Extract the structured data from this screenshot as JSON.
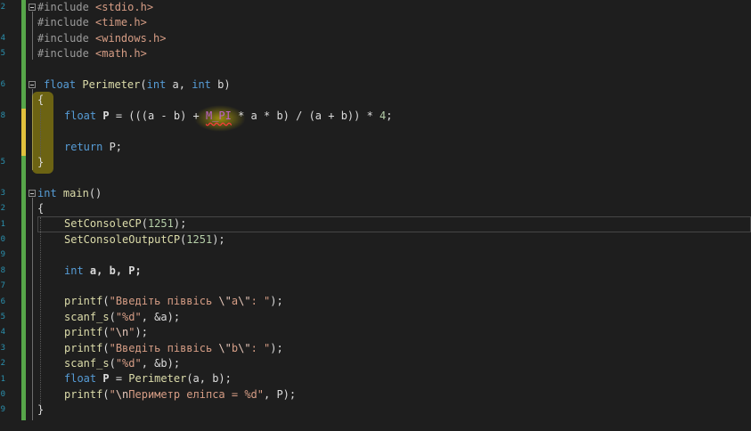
{
  "colors": {
    "background": "#1e1e1e",
    "keyword": "#569cd6",
    "function": "#dcdcaa",
    "string": "#d69d85",
    "macro": "#bd63c5",
    "number": "#b5cea8",
    "changed_saved": "#57a64a",
    "changed_unsaved": "#e2c13d",
    "highlight": "#ffe600"
  },
  "line_number_fragments": [
    "2",
    "4",
    "5",
    "6",
    "8",
    "5",
    "3",
    "2",
    "1",
    "0",
    "9",
    "8",
    "7",
    "6",
    "5",
    "4",
    "3",
    "2",
    "1",
    "0",
    "9",
    "8",
    "7",
    "6",
    "5",
    "4",
    "3"
  ],
  "code": {
    "l1": [
      "#include ",
      "<stdio.h>"
    ],
    "l2": [
      "#include ",
      "<time.h>"
    ],
    "l3": [
      "#include ",
      "<windows.h>"
    ],
    "l4": [
      "#include ",
      "<math.h>"
    ],
    "l6": [
      "float",
      " ",
      "Perimeter",
      "(",
      "int",
      " a, ",
      "int",
      " b)"
    ],
    "l7": [
      "{"
    ],
    "l8": [
      "float",
      " ",
      "P",
      " = (((a - b) + ",
      "M_PI",
      " * a * b) / (a + b)) * ",
      "4",
      ";"
    ],
    "l10": [
      "return",
      " P;"
    ],
    "l11": [
      "}"
    ],
    "l13": [
      "int",
      " ",
      "main",
      "()"
    ],
    "l14": [
      "{"
    ],
    "l15": [
      "SetConsoleCP",
      "(",
      "1251",
      ");"
    ],
    "l16": [
      "SetConsoleOutputCP",
      "(",
      "1251",
      ");"
    ],
    "l18": [
      "int",
      " ",
      "a, b, P;"
    ],
    "l20": [
      "printf",
      "(",
      "\"Введіть піввісь ",
      "\\\"",
      "a",
      "\\\"",
      ": \"",
      ");"
    ],
    "l21": [
      "scanf_s",
      "(",
      "\"%d\"",
      ", &a);"
    ],
    "l22": [
      "printf",
      "(",
      "\"",
      "\\n",
      "\"",
      ");"
    ],
    "l23": [
      "printf",
      "(",
      "\"Введіть піввісь ",
      "\\\"",
      "b",
      "\\\"",
      ": \"",
      ");"
    ],
    "l24": [
      "scanf_s",
      "(",
      "\"%d\"",
      ", &b);"
    ],
    "l25": [
      "float",
      " ",
      "P",
      " = ",
      "Perimeter",
      "(a, b);"
    ],
    "l26": [
      "printf",
      "(",
      "\"",
      "\\n",
      "Периметр еліпса = %d\"",
      ", P);"
    ],
    "l27": [
      "}"
    ]
  }
}
